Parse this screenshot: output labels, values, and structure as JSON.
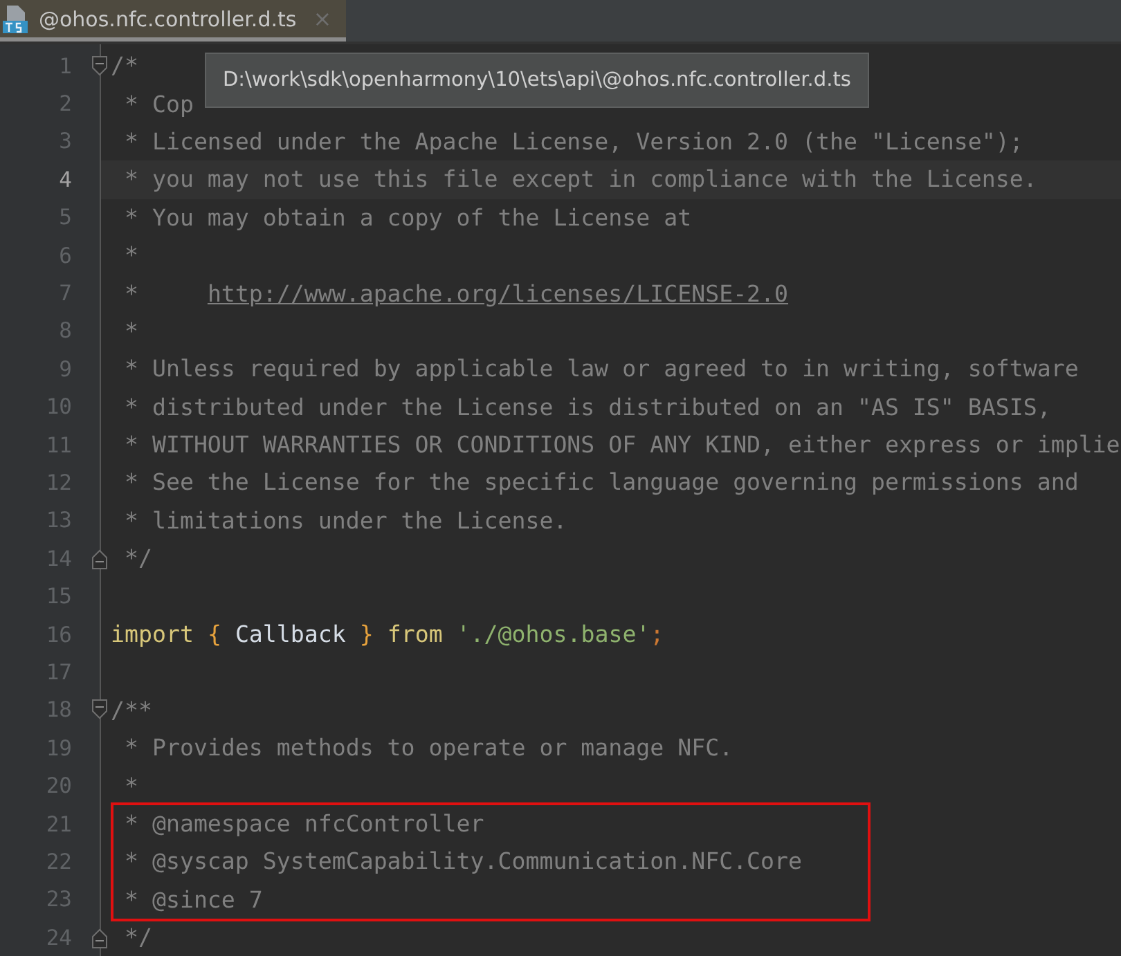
{
  "tabs": [
    {
      "label": "@ohos.nfc.controller.d.ts",
      "selected": true,
      "close": "×"
    }
  ],
  "tooltip": {
    "text": "D:\\work\\sdk\\openharmony\\10\\ets\\api\\@ohos.nfc.controller.d.ts"
  },
  "editor": {
    "lines": [
      {
        "number": "1",
        "current": false,
        "fold_start": true,
        "fold_end": false,
        "tokens": [
          {
            "kind": "comment",
            "text": "/*"
          }
        ]
      },
      {
        "number": "2",
        "current": false,
        "fold_start": false,
        "fold_end": false,
        "tokens": [
          {
            "kind": "comment",
            "text": " * Cop"
          }
        ]
      },
      {
        "number": "3",
        "current": false,
        "fold_start": false,
        "fold_end": false,
        "tokens": [
          {
            "kind": "comment",
            "text": " * Licensed under the Apache License, Version 2.0 (the \"License\");"
          }
        ]
      },
      {
        "number": "4",
        "current": true,
        "fold_start": false,
        "fold_end": false,
        "tokens": [
          {
            "kind": "comment",
            "text": " * you may not use this file except in compliance with the License."
          }
        ]
      },
      {
        "number": "5",
        "current": false,
        "fold_start": false,
        "fold_end": false,
        "tokens": [
          {
            "kind": "comment",
            "text": " * You may obtain a copy of the License at"
          }
        ]
      },
      {
        "number": "6",
        "current": false,
        "fold_start": false,
        "fold_end": false,
        "tokens": [
          {
            "kind": "comment",
            "text": " *"
          }
        ]
      },
      {
        "number": "7",
        "current": false,
        "fold_start": false,
        "fold_end": false,
        "tokens": [
          {
            "kind": "comment",
            "text": " *     "
          },
          {
            "kind": "link",
            "text": "http://www.apache.org/licenses/LICENSE-2.0"
          }
        ]
      },
      {
        "number": "8",
        "current": false,
        "fold_start": false,
        "fold_end": false,
        "tokens": [
          {
            "kind": "comment",
            "text": " *"
          }
        ]
      },
      {
        "number": "9",
        "current": false,
        "fold_start": false,
        "fold_end": false,
        "tokens": [
          {
            "kind": "comment",
            "text": " * Unless required by applicable law or agreed to in writing, software"
          }
        ]
      },
      {
        "number": "10",
        "current": false,
        "fold_start": false,
        "fold_end": false,
        "tokens": [
          {
            "kind": "comment",
            "text": " * distributed under the License is distributed on an \"AS IS\" BASIS,"
          }
        ]
      },
      {
        "number": "11",
        "current": false,
        "fold_start": false,
        "fold_end": false,
        "tokens": [
          {
            "kind": "comment",
            "text": " * WITHOUT WARRANTIES OR CONDITIONS OF ANY KIND, either express or implie"
          }
        ]
      },
      {
        "number": "12",
        "current": false,
        "fold_start": false,
        "fold_end": false,
        "tokens": [
          {
            "kind": "comment",
            "text": " * See the License for the specific language governing permissions and"
          }
        ]
      },
      {
        "number": "13",
        "current": false,
        "fold_start": false,
        "fold_end": false,
        "tokens": [
          {
            "kind": "comment",
            "text": " * limitations under the License."
          }
        ]
      },
      {
        "number": "14",
        "current": false,
        "fold_start": false,
        "fold_end": true,
        "tokens": [
          {
            "kind": "comment",
            "text": " */"
          }
        ]
      },
      {
        "number": "15",
        "current": false,
        "fold_start": false,
        "fold_end": false
      },
      {
        "number": "16",
        "current": false,
        "fold_start": false,
        "fold_end": false,
        "tokens": [
          {
            "kind": "keyword",
            "text": "import"
          },
          {
            "kind": "brace",
            "text": " { "
          },
          {
            "kind": "ident",
            "text": "Callback"
          },
          {
            "kind": "brace",
            "text": " } "
          },
          {
            "kind": "keyword",
            "text": "from"
          },
          {
            "kind": "string",
            "text": " './@ohos.base'"
          },
          {
            "kind": "punct",
            "text": ";"
          }
        ]
      },
      {
        "number": "17",
        "current": false,
        "fold_start": false,
        "fold_end": false
      },
      {
        "number": "18",
        "current": false,
        "fold_start": true,
        "fold_end": false,
        "tokens": [
          {
            "kind": "comment",
            "text": "/**"
          }
        ]
      },
      {
        "number": "19",
        "current": false,
        "fold_start": false,
        "fold_end": false,
        "tokens": [
          {
            "kind": "comment",
            "text": " * Provides methods to operate or manage NFC."
          }
        ]
      },
      {
        "number": "20",
        "current": false,
        "fold_start": false,
        "fold_end": false,
        "tokens": [
          {
            "kind": "comment",
            "text": " *"
          }
        ]
      },
      {
        "number": "21",
        "current": false,
        "fold_start": false,
        "fold_end": false,
        "tokens": [
          {
            "kind": "comment",
            "text": " * @namespace nfcController"
          }
        ]
      },
      {
        "number": "22",
        "current": false,
        "fold_start": false,
        "fold_end": false,
        "tokens": [
          {
            "kind": "comment",
            "text": " * @syscap SystemCapability.Communication.NFC.Core"
          }
        ]
      },
      {
        "number": "23",
        "current": false,
        "fold_start": false,
        "fold_end": false,
        "tokens": [
          {
            "kind": "comment",
            "text": " * @since 7"
          }
        ]
      },
      {
        "number": "24",
        "current": false,
        "fold_start": false,
        "fold_end": true,
        "tokens": [
          {
            "kind": "comment",
            "text": " */"
          }
        ]
      }
    ]
  }
}
